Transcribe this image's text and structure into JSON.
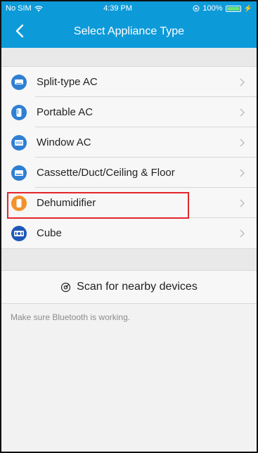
{
  "status_bar": {
    "carrier": "No SIM",
    "time": "4:39 PM",
    "battery": "100%"
  },
  "nav": {
    "title": "Select Appliance Type"
  },
  "appliances": [
    {
      "label": "Split-type AC",
      "icon": "split-ac-icon"
    },
    {
      "label": "Portable AC",
      "icon": "portable-ac-icon"
    },
    {
      "label": "Window AC",
      "icon": "window-ac-icon"
    },
    {
      "label": "Cassette/Duct/Ceiling & Floor",
      "icon": "cassette-icon"
    },
    {
      "label": "Dehumidifier",
      "icon": "dehumidifier-icon"
    },
    {
      "label": "Cube",
      "icon": "cube-icon"
    }
  ],
  "scan": {
    "label": "Scan for nearby devices"
  },
  "hint": "Make sure Bluetooth is working.",
  "colors": {
    "header": "#0d9ad9",
    "icon_blue": "#2f7fd3",
    "icon_orange": "#f3922b",
    "highlight": "#e5252a"
  }
}
